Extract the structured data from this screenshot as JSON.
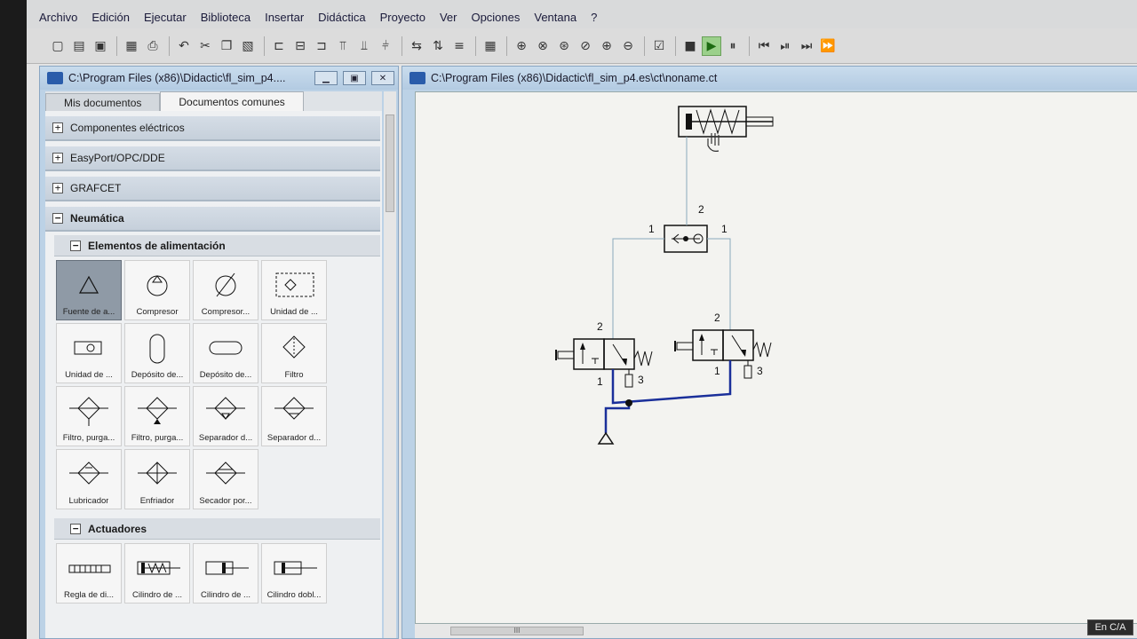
{
  "menu": [
    "Archivo",
    "Edición",
    "Ejecutar",
    "Biblioteca",
    "Insertar",
    "Didáctica",
    "Proyecto",
    "Ver",
    "Opciones",
    "Ventana",
    "?"
  ],
  "toolbar_icons": [
    "new-icon",
    "open-icon",
    "save-icon",
    "print-preview-icon",
    "print-icon",
    "undo-icon",
    "cut-icon",
    "copy-icon",
    "paste-icon",
    "align-left-icon",
    "align-center-icon",
    "align-right-icon",
    "align-top-icon",
    "align-middle-icon",
    "align-bottom-icon",
    "flip-h-icon",
    "flip-v-icon",
    "rotate-icon",
    "grid-icon",
    "zoom-fit-icon",
    "zoom-window-icon",
    "zoom-icon",
    "zoom-prev-icon",
    "zoom-in-icon",
    "zoom-out-icon",
    "check-icon",
    "stop-icon",
    "play-icon",
    "pause-icon",
    "rewind-icon",
    "step-icon",
    "step-fwd-icon",
    "fast-forward-icon"
  ],
  "library": {
    "title": "C:\\Program Files (x86)\\Didactic\\fl_sim_p4....",
    "tabs": [
      "Mis documentos",
      "Documentos comunes"
    ],
    "groups": [
      "Componentes eléctricos",
      "EasyPort/OPC/DDE",
      "GRAFCET"
    ],
    "neumatica": "Neumática",
    "alimentacion": "Elementos de alimentación",
    "tiles": [
      "Fuente de a...",
      "Compresor",
      "Compresor...",
      "Unidad de ...",
      "Unidad de ...",
      "Depósito de...",
      "Depósito de...",
      "Filtro",
      "Filtro, purga...",
      "Filtro, purga...",
      "Separador d...",
      "Separador d...",
      "Lubricador",
      "Enfriador",
      "Secador por..."
    ],
    "actuadores": "Actuadores",
    "act_tiles": [
      "Regla de di...",
      "Cilindro de ...",
      "Cilindro de ...",
      "Cilindro dobl..."
    ]
  },
  "canvas": {
    "title": "C:\\Program Files (x86)\\Didactic\\fl_sim_p4.es\\ct\\noname.ct",
    "port_labels": {
      "shuttle_top": "2",
      "shuttle_left": "1",
      "shuttle_right": "1",
      "v1_top": "2",
      "v1_bottom": "1",
      "v1_exhaust": "3",
      "v2_top": "2",
      "v2_bottom": "1",
      "v2_exhaust": "3"
    }
  },
  "hscroll_label": "III",
  "status": "En C/A"
}
